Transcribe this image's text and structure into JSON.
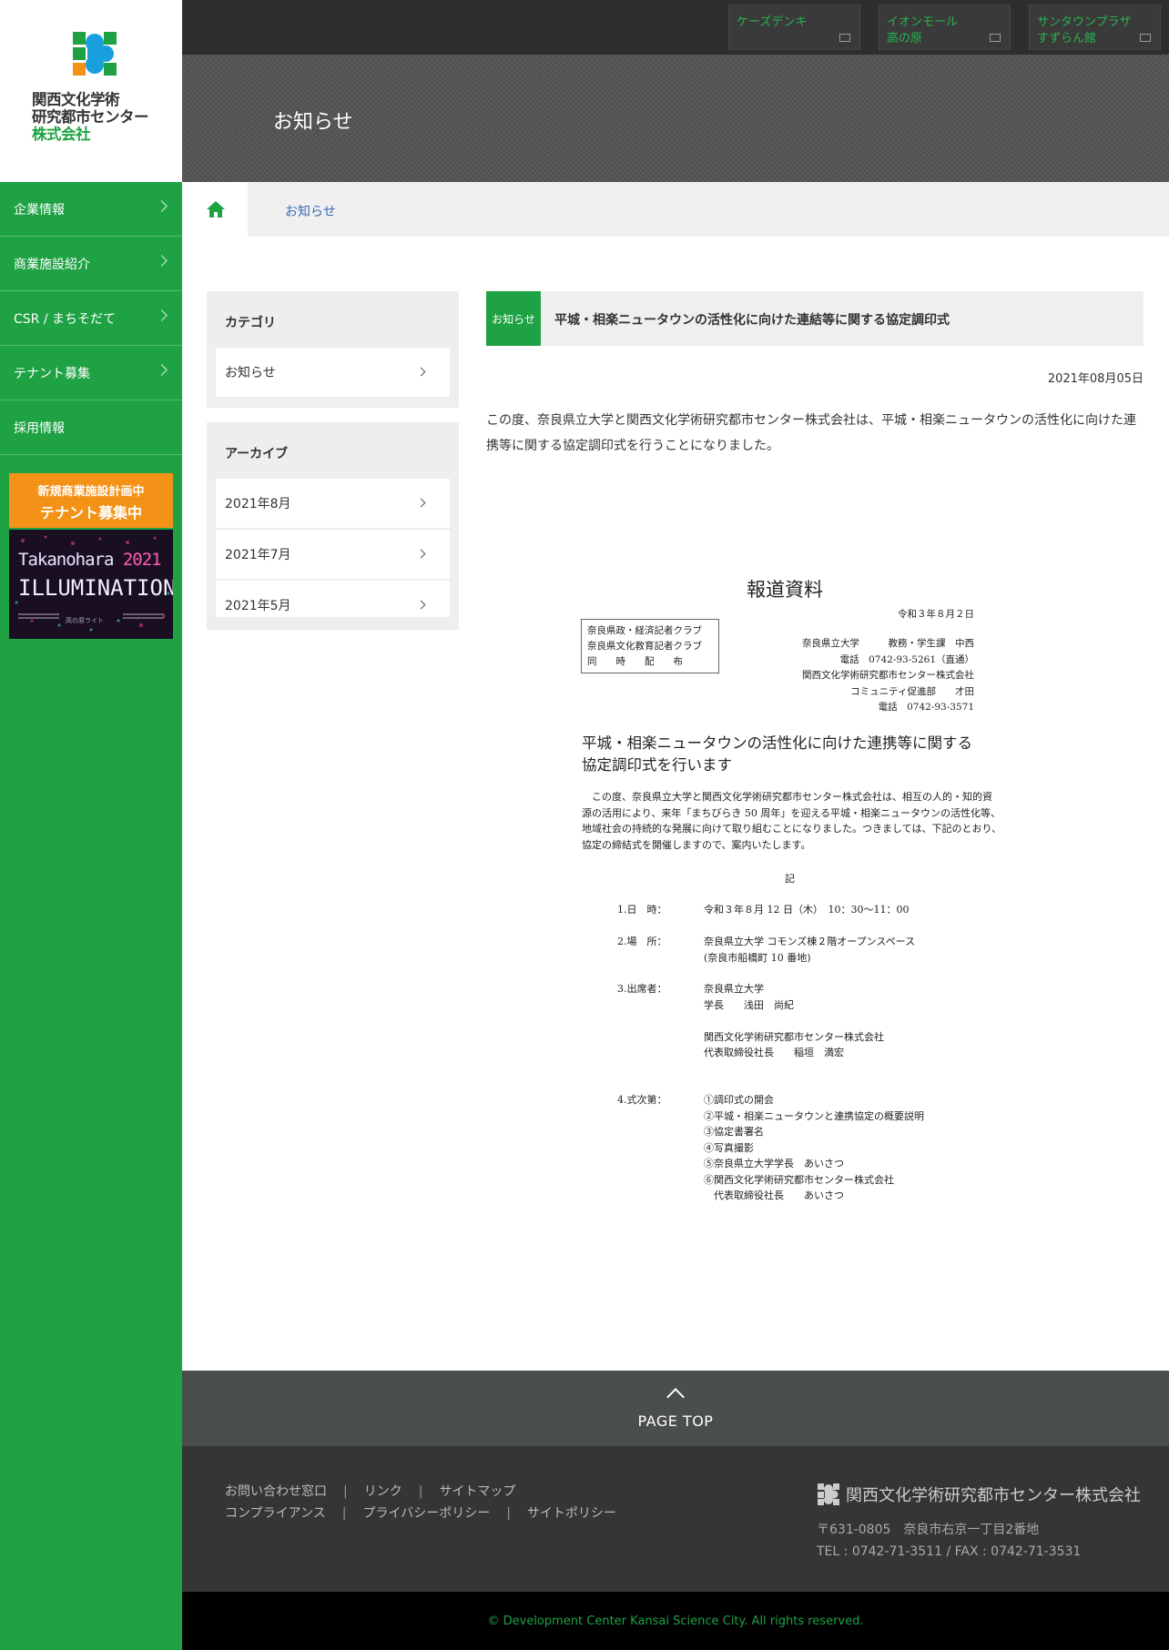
{
  "logo": {
    "line1": "関西文化学術",
    "line2": "研究都市センター",
    "line3": "株式会社"
  },
  "sidebar": {
    "items": [
      {
        "label": "企業情報"
      },
      {
        "label": "商業施設紹介"
      },
      {
        "label": "CSR / まちそだて"
      },
      {
        "label": "テナント募集"
      },
      {
        "label": "採用情報"
      }
    ],
    "banner_tenant": {
      "line1": "新規商業施設計画中",
      "line2": "テナント募集中"
    },
    "banner_illumination": {
      "line1": "Takanohara",
      "year": "2021",
      "line2": "ILLUMINATION",
      "caption": "高の原ライト"
    }
  },
  "topbar": {
    "stores": [
      {
        "line1": "ケーズデンキ",
        "line2": ""
      },
      {
        "line1": "イオンモール",
        "line2": "高の原"
      },
      {
        "line1": "サンタウンプラザ",
        "line2": "すずらん館"
      }
    ]
  },
  "hero": {
    "title": "お知らせ"
  },
  "breadcrumb": {
    "current": "お知らせ"
  },
  "side_menu": {
    "category_heading": "カテゴリ",
    "categories": [
      {
        "label": "お知らせ"
      }
    ],
    "archive_heading": "アーカイブ",
    "archives": [
      {
        "label": "2021年8月"
      },
      {
        "label": "2021年7月"
      },
      {
        "label": "2021年5月"
      }
    ]
  },
  "article": {
    "category": "お知らせ",
    "title": "平城・相楽ニュータウンの活性化に向けた連結等に関する協定調印式",
    "date": "2021年08月05日",
    "body": "この度、奈良県立大学と関西文化学術研究都市センター株式会社は、平城・相楽ニュータウンの活性化に向けた連携等に関する協定調印式を行うことになりました。"
  },
  "press_doc": {
    "heading": "報道資料",
    "date": "令和３年８月２日",
    "box": [
      "奈良県政・経済記者クラブ",
      "奈良県文化教育記者クラブ",
      "同　　時　　配　　布"
    ],
    "contacts": [
      "奈良県立大学　　　教務・学生課　中西",
      "電話　0742-93-5261（直通）",
      "関西文化学術研究都市センター株式会社",
      "コミュニティ促進部　　才田",
      "電話　0742-93-3571"
    ],
    "title_line1": "平城・相楽ニュータウンの活性化に向けた連携等に関する",
    "title_line2": "協定調印式を行います",
    "body": [
      "　この度、奈良県立大学と関西文化学術研究都市センター株式会社は、相互の人的・知的資",
      "源の活用により、来年「まちびらき 50 周年」を迎える平城・相楽ニュータウンの活性化等、",
      "地域社会の持続的な発展に向けて取り組むことになりました。つきましては、下記のとおり、",
      "協定の締結式を開催しますので、案内いたします。"
    ],
    "ki": "記",
    "items": [
      {
        "label": "1.日　時：",
        "lines": [
          "令和３年８月 12 日（木）　10：30〜11：00"
        ]
      },
      {
        "label": "2.場　所：",
        "lines": [
          "奈良県立大学 コモンズ棟２階オープンスペース",
          "(奈良市船橋町 10 番地)"
        ]
      },
      {
        "label": "3.出席者：",
        "lines": [
          "奈良県立大学",
          "学長　　浅田　尚紀",
          "",
          "関西文化学術研究都市センター株式会社",
          "代表取締役社長　　稲垣　満宏"
        ]
      },
      {
        "label": "4.式次第：",
        "lines": [
          "①調印式の開会",
          "②平城・相楽ニュータウンと連携協定の概要説明",
          "③協定書署名",
          "④写真撮影",
          "⑤奈良県立大学学長　あいさつ",
          "⑥関西文化学術研究都市センター株式会社",
          "　代表取締役社長　　あいさつ"
        ]
      }
    ]
  },
  "footer": {
    "pagetop": "PAGE TOP",
    "links_row1": [
      "お問い合わせ窓口",
      "リンク",
      "サイトマップ"
    ],
    "links_row2": [
      "コンプライアンス",
      "プライバシーポリシー",
      "サイトポリシー"
    ],
    "company": "関西文化学術研究都市センター株式会社",
    "address": "〒631-0805　奈良市右京一丁目2番地",
    "tel": "TEL : 0742-71-3511 / FAX : 0742-71-3531",
    "copyright": "© Development Center Kansai Science City. All rights reserved."
  },
  "colors": {
    "brand_green": "#1fa244",
    "accent_orange": "#f39217",
    "logo_blue": "#1a9fde"
  }
}
